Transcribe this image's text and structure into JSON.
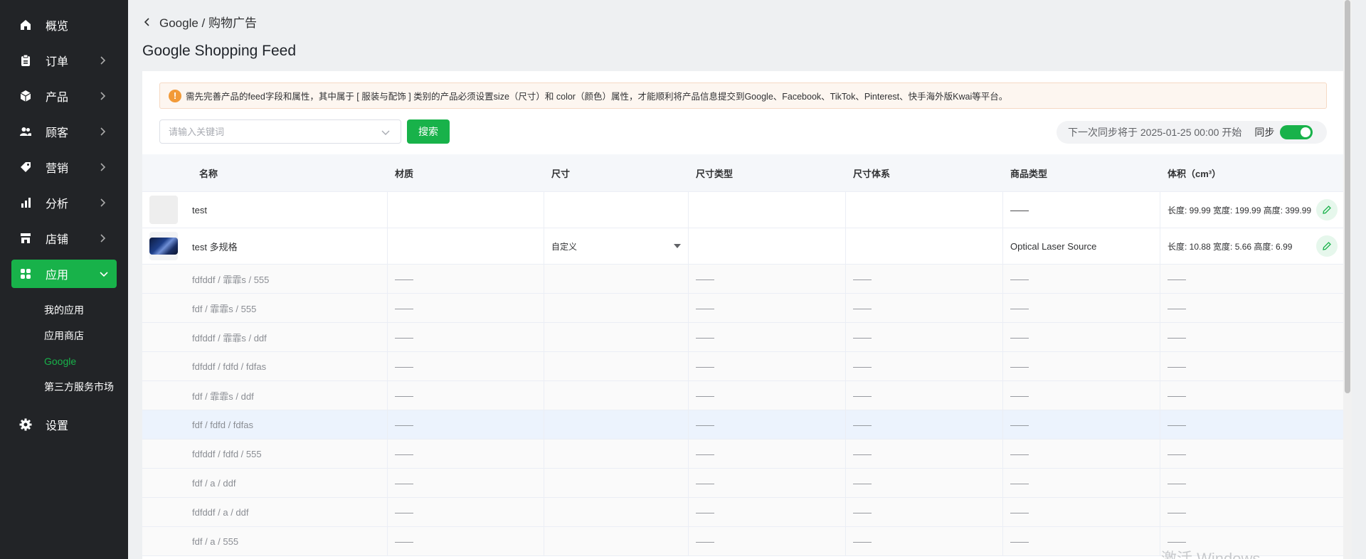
{
  "sidebar": {
    "items": [
      {
        "label": "概览",
        "icon": "home-icon"
      },
      {
        "label": "订单",
        "icon": "clipboard-icon"
      },
      {
        "label": "产品",
        "icon": "box-icon"
      },
      {
        "label": "顾客",
        "icon": "users-icon"
      },
      {
        "label": "营销",
        "icon": "tag-icon"
      },
      {
        "label": "分析",
        "icon": "bar-chart-icon"
      },
      {
        "label": "店铺",
        "icon": "store-icon"
      },
      {
        "label": "应用",
        "icon": "apps-icon"
      }
    ],
    "sub_items": [
      "我的应用",
      "应用商店",
      "Google",
      "第三方服务市场"
    ],
    "settings_label": "设置"
  },
  "breadcrumb": "Google / 购物广告",
  "page_title": "Google Shopping Feed",
  "notice": "需先完善产品的feed字段和属性，其中属于 [ 服装与配饰 ] 类别的产品必须设置size（尺寸）和 color（颜色）属性，才能顺利将产品信息提交到Google、Facebook、TikTok、Pinterest、快手海外版Kwai等平台。",
  "search": {
    "placeholder": "请输入关键词",
    "button_label": "搜索"
  },
  "sync": {
    "next_text": "下一次同步将于 2025-01-25 00:00 开始",
    "label": "同步",
    "enabled": true
  },
  "table": {
    "headers": [
      "名称",
      "材质",
      "尺寸",
      "尺寸类型",
      "尺寸体系",
      "商品类型",
      "体积（cm³）"
    ],
    "main_rows": [
      {
        "name": "test",
        "material": "",
        "size": "",
        "size_type": "",
        "size_system": "",
        "product_type": "——",
        "volume": "长度: 99.99 宽度: 199.99 高度: 399.99"
      },
      {
        "name": "test 多规格",
        "material": "",
        "size": "自定义",
        "size_type": "",
        "size_system": "",
        "product_type": "Optical Laser Source",
        "volume": "长度: 10.88 宽度: 5.66 高度: 6.99"
      }
    ],
    "variant_rows": [
      "fdfddf / 霏霏s / 555",
      "fdf / 霏霏s / 555",
      "fdfddf / 霏霏s / ddf",
      "fdfddf / fdfd / fdfas",
      "fdf / 霏霏s / ddf",
      "fdf / fdfd / fdfas",
      "fdfddf / fdfd / 555",
      "fdf / a / ddf",
      "fdfddf / a / ddf",
      "fdf / a / 555"
    ],
    "dash": "——"
  },
  "watermark": "激活 Windows",
  "colors": {
    "accent": "#18b24a",
    "sidebar_bg": "#222427",
    "warning": "#f29a38"
  }
}
